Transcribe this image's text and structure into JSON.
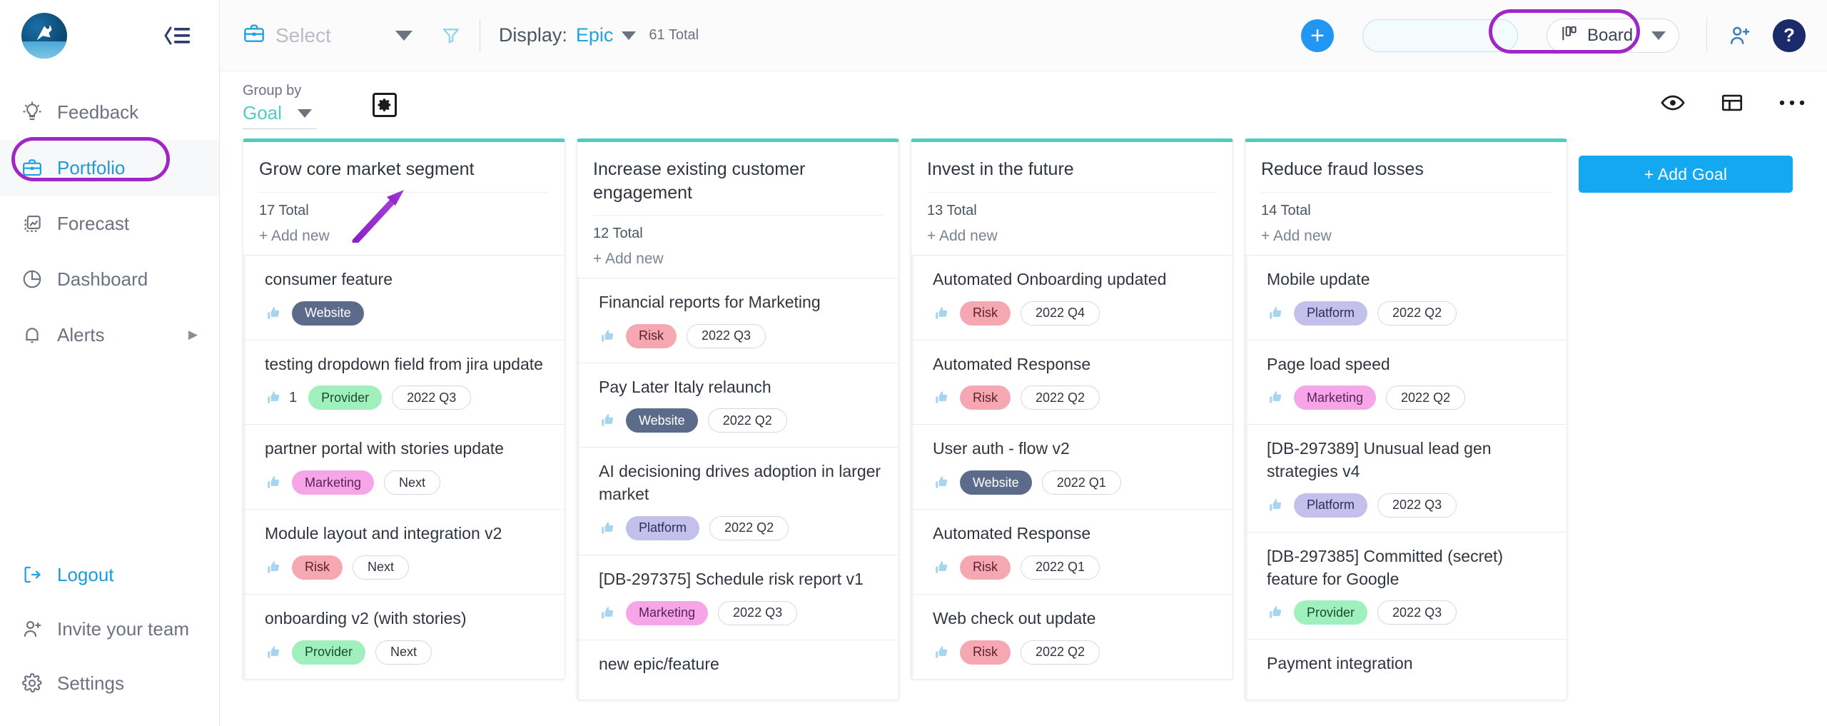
{
  "sidebar": {
    "logo_name": "app-logo",
    "collapse_icon": "collapse-sidebar-icon",
    "items": [
      {
        "label": "Feedback",
        "icon": "lightbulb-icon",
        "active": false
      },
      {
        "label": "Portfolio",
        "icon": "briefcase-icon",
        "active": true
      },
      {
        "label": "Forecast",
        "icon": "forecast-icon",
        "active": false
      },
      {
        "label": "Dashboard",
        "icon": "pie-chart-icon",
        "active": false
      },
      {
        "label": "Alerts",
        "icon": "bell-icon",
        "active": false,
        "has_submenu": true
      }
    ],
    "bottom_items": [
      {
        "label": "Logout",
        "icon": "logout-icon"
      },
      {
        "label": "Invite your team",
        "icon": "user-plus-icon"
      },
      {
        "label": "Settings",
        "icon": "gear-icon"
      }
    ]
  },
  "topbar": {
    "select_label": "Select",
    "select_icon": "briefcase-icon",
    "filter_icon": "funnel-icon",
    "display_label": "Display:",
    "display_value": "Epic",
    "total_label": "61 Total",
    "add_button": "+",
    "search_placeholder": "",
    "search_value": "",
    "search_icon": "search-icon",
    "board_label": "Board",
    "board_icon": "board-columns-icon",
    "invite_icon": "user-plus-icon",
    "help_label": "?"
  },
  "subbar": {
    "group_by_label": "Group by",
    "group_by_value": "Goal",
    "config_icon": "settings-square-icon",
    "eye_icon": "eye-icon",
    "layout_icon": "layout-icon",
    "more_icon": "more-horizontal-icon"
  },
  "board": {
    "add_goal_label": "+ Add Goal",
    "add_new_label": "+ Add new",
    "columns": [
      {
        "title": "Grow core market segment",
        "total": "17 Total",
        "cards": [
          {
            "title": "consumer feature",
            "votes": "",
            "tags": [
              {
                "text": "Website",
                "style": "website"
              }
            ]
          },
          {
            "title": "testing dropdown field from jira update",
            "votes": "1",
            "tags": [
              {
                "text": "Provider",
                "style": "provider"
              },
              {
                "text": "2022 Q3",
                "style": "outline"
              }
            ]
          },
          {
            "title": "partner portal with stories update",
            "votes": "",
            "tags": [
              {
                "text": "Marketing",
                "style": "marketing"
              },
              {
                "text": "Next",
                "style": "outline"
              }
            ]
          },
          {
            "title": "Module layout and integration v2",
            "votes": "",
            "tags": [
              {
                "text": "Risk",
                "style": "risk"
              },
              {
                "text": "Next",
                "style": "outline"
              }
            ]
          },
          {
            "title": "onboarding v2 (with stories)",
            "votes": "",
            "tags": [
              {
                "text": "Provider",
                "style": "provider"
              },
              {
                "text": "Next",
                "style": "outline"
              }
            ]
          }
        ]
      },
      {
        "title": "Increase existing customer engagement",
        "total": "12 Total",
        "cards": [
          {
            "title": "Financial reports for Marketing",
            "votes": "",
            "tags": [
              {
                "text": "Risk",
                "style": "risk"
              },
              {
                "text": "2022 Q3",
                "style": "outline"
              }
            ]
          },
          {
            "title": "Pay Later Italy relaunch",
            "votes": "",
            "tags": [
              {
                "text": "Website",
                "style": "website"
              },
              {
                "text": "2022 Q2",
                "style": "outline"
              }
            ]
          },
          {
            "title": "AI decisioning drives adoption in larger market",
            "votes": "",
            "tags": [
              {
                "text": "Platform",
                "style": "platform"
              },
              {
                "text": "2022 Q2",
                "style": "outline"
              }
            ]
          },
          {
            "title": "[DB-297375] Schedule risk report v1",
            "votes": "",
            "tags": [
              {
                "text": "Marketing",
                "style": "marketing"
              },
              {
                "text": "2022 Q3",
                "style": "outline"
              }
            ]
          },
          {
            "title": "new epic/feature",
            "votes": "",
            "tags": []
          }
        ]
      },
      {
        "title": "Invest in the future",
        "total": "13 Total",
        "cards": [
          {
            "title": "Automated Onboarding updated",
            "votes": "",
            "tags": [
              {
                "text": "Risk",
                "style": "risk"
              },
              {
                "text": "2022 Q4",
                "style": "outline"
              }
            ]
          },
          {
            "title": "Automated Response",
            "votes": "",
            "tags": [
              {
                "text": "Risk",
                "style": "risk"
              },
              {
                "text": "2022 Q2",
                "style": "outline"
              }
            ]
          },
          {
            "title": "User auth - flow v2",
            "votes": "",
            "tags": [
              {
                "text": "Website",
                "style": "website"
              },
              {
                "text": "2022 Q1",
                "style": "outline"
              }
            ]
          },
          {
            "title": "Automated Response",
            "votes": "",
            "tags": [
              {
                "text": "Risk",
                "style": "risk"
              },
              {
                "text": "2022 Q1",
                "style": "outline"
              }
            ]
          },
          {
            "title": "Web check out update",
            "votes": "",
            "tags": [
              {
                "text": "Risk",
                "style": "risk"
              },
              {
                "text": "2022 Q2",
                "style": "outline"
              }
            ]
          }
        ]
      },
      {
        "title": "Reduce fraud losses",
        "total": "14 Total",
        "cards": [
          {
            "title": "Mobile update",
            "votes": "",
            "tags": [
              {
                "text": "Platform",
                "style": "platform"
              },
              {
                "text": "2022 Q2",
                "style": "outline"
              }
            ]
          },
          {
            "title": "Page load speed",
            "votes": "",
            "tags": [
              {
                "text": "Marketing",
                "style": "marketing"
              },
              {
                "text": "2022 Q2",
                "style": "outline"
              }
            ]
          },
          {
            "title": "[DB-297389] Unusual lead gen strategies v4",
            "votes": "",
            "tags": [
              {
                "text": "Platform",
                "style": "platform"
              },
              {
                "text": "2022 Q3",
                "style": "outline"
              }
            ]
          },
          {
            "title": "[DB-297385] Committed (secret) feature for Google",
            "votes": "",
            "tags": [
              {
                "text": "Provider",
                "style": "provider"
              },
              {
                "text": "2022 Q3",
                "style": "outline"
              }
            ]
          },
          {
            "title": "Payment integration",
            "votes": "",
            "tags": []
          }
        ]
      }
    ]
  },
  "annotations": {
    "highlight_color": "#a026c8",
    "arrow_target": "group-by-goal-dropdown",
    "ring_targets": [
      "sidebar-item-portfolio",
      "board-view-selector"
    ]
  }
}
